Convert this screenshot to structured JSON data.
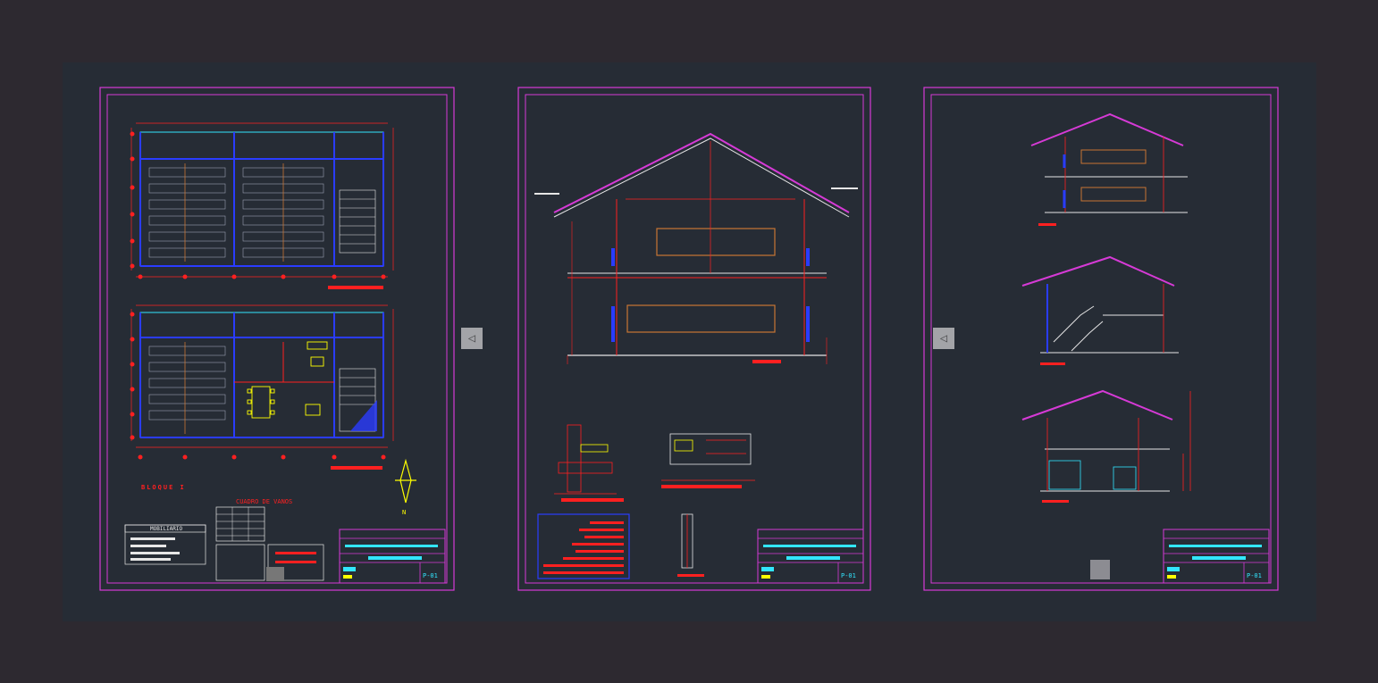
{
  "sheets": [
    {
      "id": "sheet-1",
      "texts": {
        "bloque_label": "BLOQUE I",
        "cuadro_vanos": "CUADRO DE VANOS",
        "mobiliario": "MOBILIARIO"
      },
      "sheet_code": "P-01"
    },
    {
      "id": "sheet-2",
      "sheet_code": "P-01"
    },
    {
      "id": "sheet-3",
      "sheet_code": "P-01"
    }
  ],
  "colors": {
    "background": "#2d2930",
    "canvas": "#262c35",
    "frame": "#d63ad6",
    "line_red": "#ff2020",
    "line_blue": "#2a3cff",
    "line_cyan": "#32e6ff",
    "line_yellow": "#ffff00",
    "line_white": "#e6e6e6"
  },
  "nav": {
    "prev_icon": "arrow-left-icon",
    "next_icon": "arrow-right-icon",
    "prev_glyph": "◁",
    "next_glyph": "▷"
  }
}
